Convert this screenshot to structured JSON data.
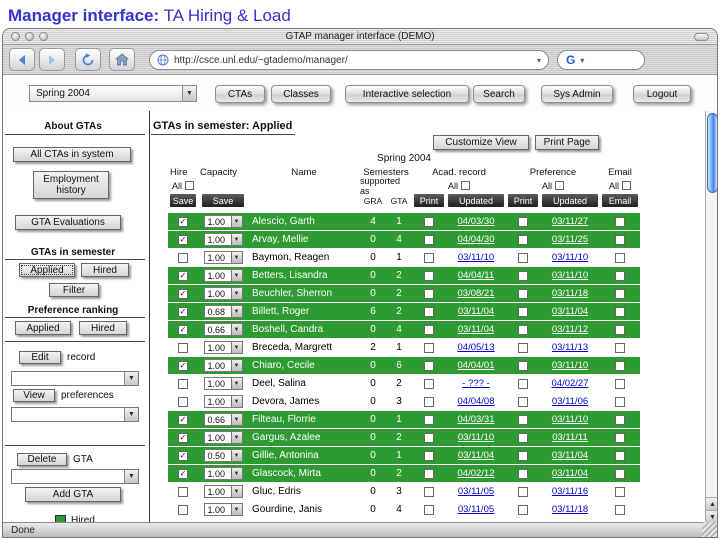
{
  "slide": {
    "title_bold": "Manager interface:",
    "title_rest": " TA Hiring & Load"
  },
  "window": {
    "title": "GTAP manager interface (DEMO)",
    "url": "http://csce.unl.edu/~gtademo/manager/",
    "status": "Done"
  },
  "nav": {
    "semester": "Spring 2004",
    "buttons": [
      "CTAs",
      "Classes",
      "Interactive selection",
      "Search",
      "Sys Admin",
      "Logout"
    ]
  },
  "sidebar": {
    "section_about": "About GTAs",
    "btn_all_ctas": "All CTAs in system",
    "btn_employment": "Employment history",
    "btn_evaluations": "GTA Evaluations",
    "section_semester": "GTAs in semester",
    "btn_applied1": "Applied",
    "btn_hired1": "Hired",
    "btn_filter": "Filter",
    "section_preference": "Preference ranking",
    "btn_applied2": "Applied",
    "btn_hired2": "Hired",
    "btn_edit": "Edit",
    "label_record": "record",
    "btn_view": "View",
    "label_preferences": "preferences",
    "btn_delete": "Delete",
    "label_gta": "GTA",
    "btn_add": "Add GTA",
    "legend_hired": "Hired"
  },
  "main": {
    "heading": "GTAs in semester: Applied",
    "btn_customize": "Customize View",
    "btn_print_page": "Print Page",
    "semester_caption": "Spring 2004",
    "table": {
      "col_hire": "Hire",
      "col_capacity": "Capacity",
      "col_name": "Name",
      "col_semesters_1": "Semesters",
      "col_semesters_2": "supported as",
      "col_acad": "Acad. record",
      "col_preference": "Preference",
      "col_email": "Email",
      "all_label": "All",
      "save_label": "Save",
      "gra_label": "GRA",
      "gta_label": "GTA",
      "print_label": "Print",
      "updated_label": "Updated",
      "email_label": "Email",
      "rows": [
        {
          "hired": true,
          "checked": true,
          "capacity": "1.00",
          "name": "Alescio, Garth",
          "gra": "4",
          "gta": "1",
          "acad_date": "04/03/30",
          "pref_date": "03/11/27"
        },
        {
          "hired": true,
          "checked": true,
          "capacity": "1.00",
          "name": "Arvay, Mellie",
          "gra": "0",
          "gta": "4",
          "acad_date": "04/04/30",
          "pref_date": "03/11/25"
        },
        {
          "hired": false,
          "checked": false,
          "capacity": "1.00",
          "name": "Baymon, Reagen",
          "gra": "0",
          "gta": "1",
          "acad_date": "03/11/10",
          "pref_date": "03/11/10"
        },
        {
          "hired": true,
          "checked": true,
          "capacity": "1.00",
          "name": "Betters, Lisandra",
          "gra": "0",
          "gta": "2",
          "acad_date": "04/04/11",
          "pref_date": "03/11/10"
        },
        {
          "hired": true,
          "checked": true,
          "capacity": "1.00",
          "name": "Beuchler, Sherron",
          "gra": "0",
          "gta": "2",
          "acad_date": "03/08/21",
          "pref_date": "03/11/18"
        },
        {
          "hired": true,
          "checked": true,
          "capacity": "0.68",
          "name": "Billett, Roger",
          "gra": "6",
          "gta": "2",
          "acad_date": "03/11/04",
          "pref_date": "03/11/04"
        },
        {
          "hired": true,
          "checked": true,
          "capacity": "0.66",
          "name": "Boshell, Candra",
          "gra": "0",
          "gta": "4",
          "acad_date": "03/11/04",
          "pref_date": "03/11/12"
        },
        {
          "hired": false,
          "checked": false,
          "capacity": "1.00",
          "name": "Breceda, Margrett",
          "gra": "2",
          "gta": "1",
          "acad_date": "04/05/13",
          "pref_date": "03/11/13"
        },
        {
          "hired": true,
          "checked": true,
          "capacity": "1.00",
          "name": "Chiaro, Cecile",
          "gra": "0",
          "gta": "6",
          "acad_date": "04/04/01",
          "pref_date": "03/11/10"
        },
        {
          "hired": false,
          "checked": false,
          "capacity": "1.00",
          "name": "Deel, Salina",
          "gra": "0",
          "gta": "2",
          "acad_date": "- ??? -",
          "pref_date": "04/02/27"
        },
        {
          "hired": false,
          "checked": false,
          "capacity": "1.00",
          "name": "Devora, James",
          "gra": "0",
          "gta": "3",
          "acad_date": "04/04/08",
          "pref_date": "03/11/06"
        },
        {
          "hired": true,
          "checked": true,
          "capacity": "0.66",
          "name": "Filteau, Florrie",
          "gra": "0",
          "gta": "1",
          "acad_date": "04/03/31",
          "pref_date": "03/11/10"
        },
        {
          "hired": true,
          "checked": true,
          "capacity": "1.00",
          "name": "Gargus, Azalee",
          "gra": "0",
          "gta": "2",
          "acad_date": "03/11/10",
          "pref_date": "03/11/11"
        },
        {
          "hired": true,
          "checked": true,
          "capacity": "0.50",
          "name": "Gillie, Antonina",
          "gra": "0",
          "gta": "1",
          "acad_date": "03/11/04",
          "pref_date": "03/11/04"
        },
        {
          "hired": true,
          "checked": true,
          "capacity": "1.00",
          "name": "Glascock, Mirta",
          "gra": "0",
          "gta": "2",
          "acad_date": "04/02/12",
          "pref_date": "03/11/04"
        },
        {
          "hired": false,
          "checked": false,
          "capacity": "1.00",
          "name": "Gluc, Edris",
          "gra": "0",
          "gta": "3",
          "acad_date": "03/11/05",
          "pref_date": "03/11/16"
        },
        {
          "hired": false,
          "checked": false,
          "capacity": "1.00",
          "name": "Gourdine, Janis",
          "gra": "0",
          "gta": "4",
          "acad_date": "03/11/05",
          "pref_date": "03/11/18"
        }
      ]
    }
  },
  "colors": {
    "hired_green": "#2e9b32",
    "link_blue": "#0000cc",
    "title_blue": "#3333cc"
  }
}
